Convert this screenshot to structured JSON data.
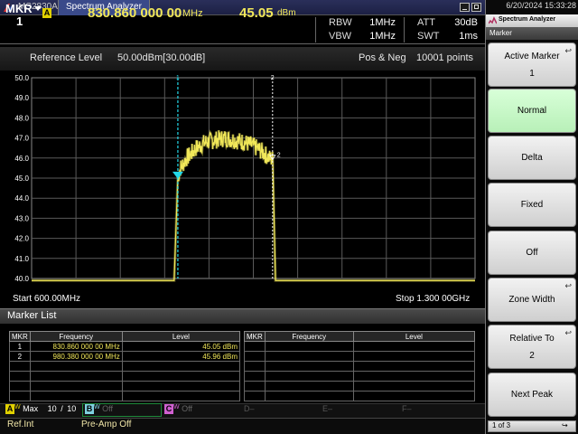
{
  "titlebar": {
    "model": "MS2830A",
    "app_title": "Spectrum Analyzer"
  },
  "header": {
    "marker_label": "MKR",
    "marker_number": "1",
    "badge": "A",
    "frequency_value": "830.860 000 00",
    "frequency_unit": "MHz",
    "level_value": "45.05",
    "level_unit": "dBm",
    "params": [
      {
        "label": "RBW",
        "value": "1MHz"
      },
      {
        "label": "VBW",
        "value": "1MHz"
      },
      {
        "label": "ATT",
        "value": "30dB"
      },
      {
        "label": "SWT",
        "value": "1ms"
      }
    ]
  },
  "graph": {
    "ref_label": "Reference Level",
    "ref_value": "50.00dBm[30.00dB]",
    "detection": "Pos & Neg",
    "points": "10001 points",
    "start": "Start 600.00MHz",
    "stop": "Stop 1.300 00GHz",
    "marker1_label": "1",
    "marker2_label": "2",
    "marker2_trace_label": "2"
  },
  "chart_data": {
    "type": "line",
    "xlabel": "",
    "ylabel": "",
    "x_range_mhz": [
      600,
      1300
    ],
    "y_range_dbm": [
      40.0,
      50.0
    ],
    "ytick_labels": [
      "50.0",
      "49.0",
      "48.0",
      "47.0",
      "46.0",
      "45.0",
      "44.0",
      "43.0",
      "42.0",
      "41.0",
      "40.0"
    ],
    "grid": true,
    "series": [
      {
        "x": [
          600,
          825,
          830.86,
          835,
          845,
          860,
          875,
          890,
          905,
          920,
          935,
          950,
          965,
          975,
          980.38,
          985,
          1300
        ],
        "y": [
          39.9,
          39.9,
          45.05,
          45.5,
          46.0,
          46.5,
          46.8,
          46.9,
          47.0,
          46.9,
          46.8,
          46.6,
          46.3,
          46.0,
          45.96,
          39.9,
          39.9
        ]
      }
    ],
    "markers": [
      {
        "id": "1",
        "x": 830.86,
        "y": 45.05
      },
      {
        "id": "2",
        "x": 980.38,
        "y": 45.96
      }
    ],
    "colors": {
      "trace": "#f2e85a",
      "marker1": "#22d8e8",
      "marker2": "#ffffff",
      "grid": "#5a5a5a"
    }
  },
  "marker_list": {
    "title": "Marker List",
    "columns": [
      "MKR",
      "Frequency",
      "Level"
    ],
    "rows": [
      {
        "mkr": "1",
        "freq": "830.860 000 00 MHz",
        "level": "45.05 dBm"
      },
      {
        "mkr": "2",
        "freq": "980.380 000 00 MHz",
        "level": "45.96 dBm"
      }
    ]
  },
  "tracebar": {
    "a_badge": "A",
    "a_sup": "W",
    "a_mode": "Max",
    "a_count": "10",
    "a_sep": "/",
    "a_total": "10",
    "b_badge": "B",
    "b_sup": "W",
    "b_state": "Off",
    "c_badge": "C",
    "c_sup": "W",
    "c_state": "Off",
    "d_badge": "D",
    "d_state": "–",
    "e_badge": "E",
    "e_state": "–",
    "f_badge": "F",
    "f_state": "–"
  },
  "status": {
    "ref": "Ref.Int",
    "preamp": "Pre-Amp Off"
  },
  "panel": {
    "datetime": "6/20/2024 15:33:28",
    "title": "Spectrum Analyzer",
    "menu": "Marker",
    "softkeys": [
      {
        "label": "Active Marker",
        "sub": "1"
      },
      {
        "label": "Normal"
      },
      {
        "label": "Delta"
      },
      {
        "label": "Fixed"
      },
      {
        "label": "Off"
      },
      {
        "label": "Zone Width"
      },
      {
        "label": "Relative To",
        "sub": "2"
      },
      {
        "label": "Next Peak"
      }
    ],
    "page": "1 of 3"
  }
}
